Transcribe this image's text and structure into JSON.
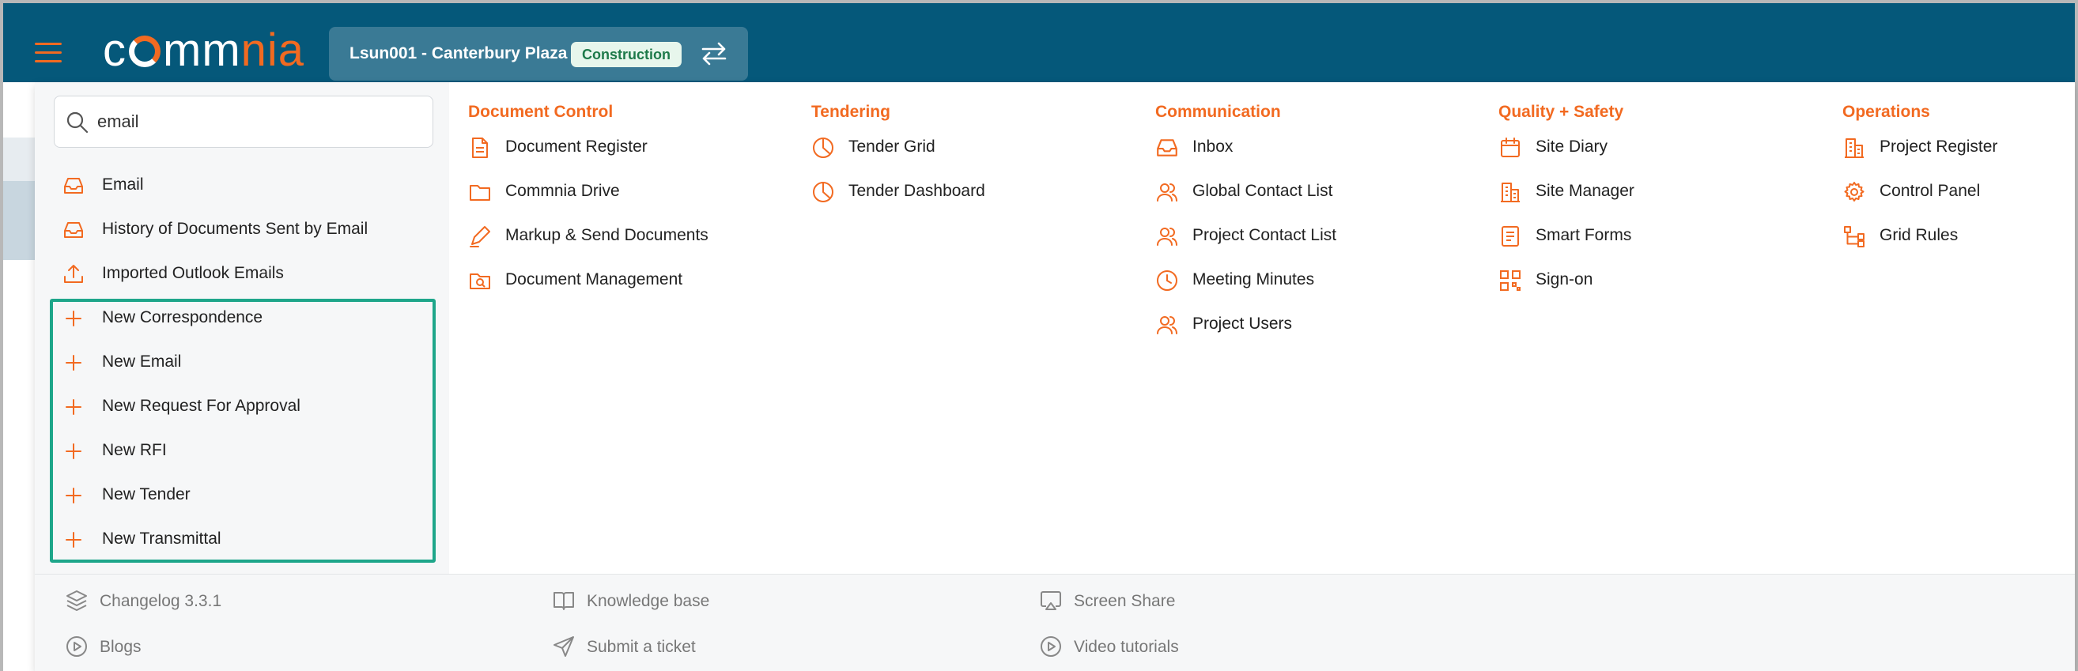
{
  "header": {
    "logo_text": "commnia",
    "project_name": "Lsun001 - Canterbury Plaza",
    "project_stage": "Construction",
    "colors": {
      "header_bg": "#05587a",
      "accent": "#f26a21",
      "highlight": "#1ea68a"
    }
  },
  "search": {
    "value": "email",
    "placeholder": ""
  },
  "results": [
    {
      "label": "Email",
      "icon": "inbox-icon"
    },
    {
      "label": "History of Documents Sent by Email",
      "icon": "inbox-icon"
    },
    {
      "label": "Imported Outlook Emails",
      "icon": "upload-icon"
    },
    {
      "label": "New Correspondence",
      "icon": "plus-icon"
    },
    {
      "label": "New Email",
      "icon": "plus-icon"
    },
    {
      "label": "New Request For Approval",
      "icon": "plus-icon"
    },
    {
      "label": "New RFI",
      "icon": "plus-icon"
    },
    {
      "label": "New Tender",
      "icon": "plus-icon"
    },
    {
      "label": "New Transmittal",
      "icon": "plus-icon"
    }
  ],
  "columns": [
    {
      "title": "Document Control",
      "items": [
        {
          "label": "Document Register",
          "icon": "document-icon"
        },
        {
          "label": "Commnia Drive",
          "icon": "folder-icon"
        },
        {
          "label": "Markup & Send Documents",
          "icon": "pen-icon"
        },
        {
          "label": "Document Management",
          "icon": "folder-search-icon"
        }
      ]
    },
    {
      "title": "Tendering",
      "items": [
        {
          "label": "Tender Grid",
          "icon": "pie-chart-icon"
        },
        {
          "label": "Tender Dashboard",
          "icon": "pie-chart-icon"
        }
      ]
    },
    {
      "title": "Communication",
      "items": [
        {
          "label": "Inbox",
          "icon": "inbox-icon"
        },
        {
          "label": "Global Contact List",
          "icon": "users-icon"
        },
        {
          "label": "Project Contact List",
          "icon": "users-icon"
        },
        {
          "label": "Meeting Minutes",
          "icon": "clock-icon"
        },
        {
          "label": "Project Users",
          "icon": "users-icon"
        }
      ]
    },
    {
      "title": "Quality + Safety",
      "items": [
        {
          "label": "Site Diary",
          "icon": "calendar-icon"
        },
        {
          "label": "Site Manager",
          "icon": "building-icon"
        },
        {
          "label": "Smart Forms",
          "icon": "form-icon"
        },
        {
          "label": "Sign-on",
          "icon": "qr-code-icon"
        }
      ]
    },
    {
      "title": "Operations",
      "items": [
        {
          "label": "Project Register",
          "icon": "building-icon"
        },
        {
          "label": "Control Panel",
          "icon": "gear-icon"
        },
        {
          "label": "Grid Rules",
          "icon": "flow-icon"
        }
      ]
    }
  ],
  "footer": [
    {
      "label": "Changelog 3.3.1",
      "icon": "layers-icon"
    },
    {
      "label": "Blogs",
      "icon": "play-circle-icon"
    },
    {
      "label": "Knowledge base",
      "icon": "book-icon"
    },
    {
      "label": "Submit a ticket",
      "icon": "send-icon"
    },
    {
      "label": "Screen Share",
      "icon": "cast-icon"
    },
    {
      "label": "Video tutorials",
      "icon": "play-circle-icon"
    }
  ]
}
